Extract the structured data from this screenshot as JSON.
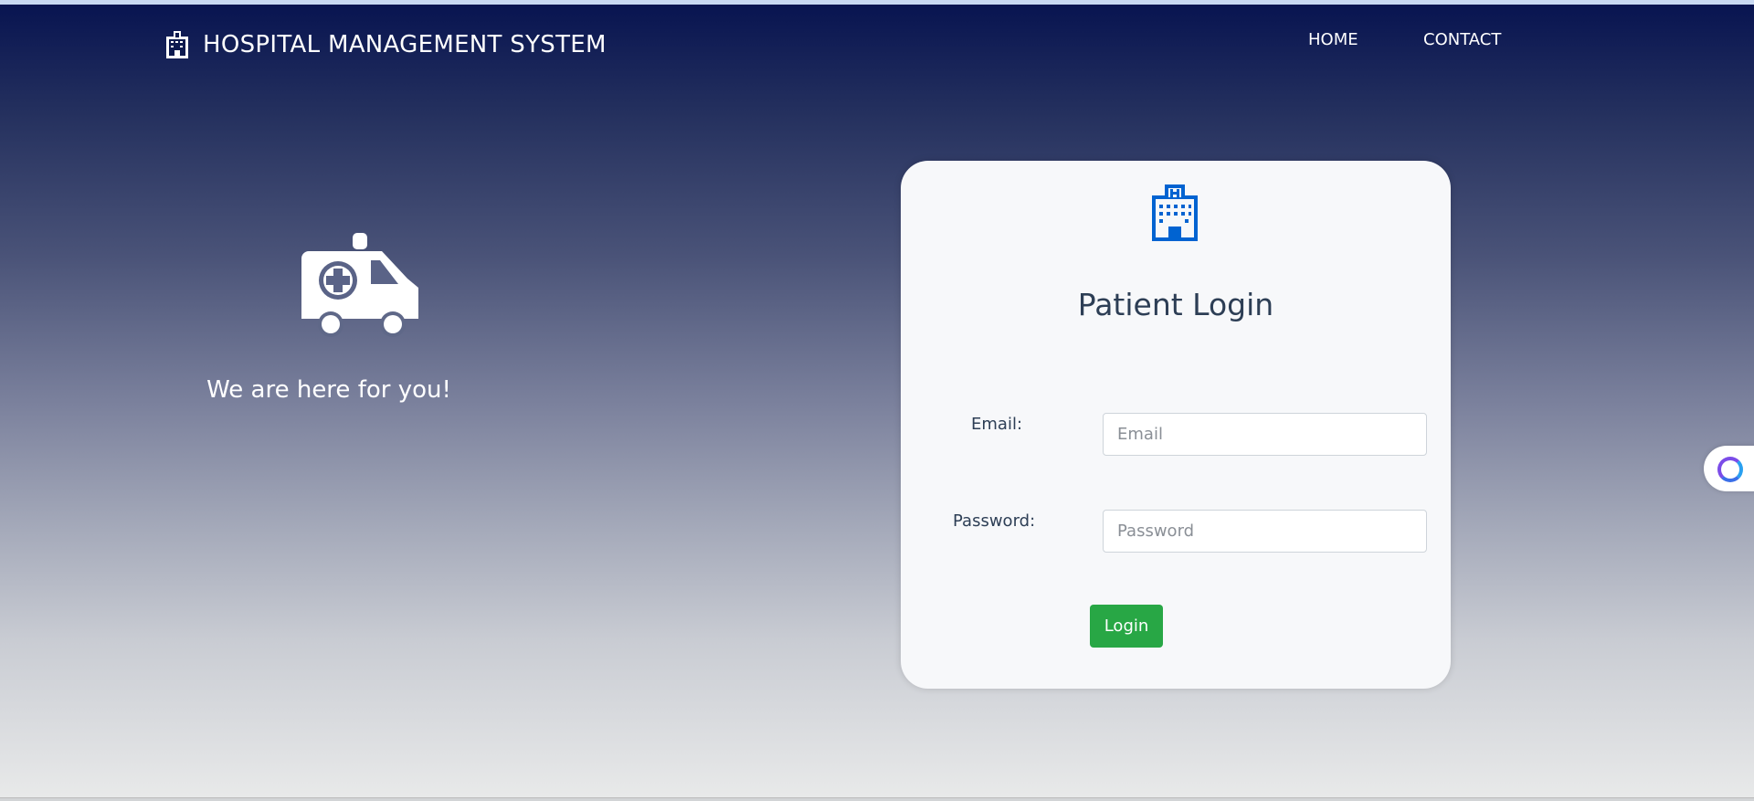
{
  "header": {
    "title": "HOSPITAL MANAGEMENT SYSTEM",
    "nav": [
      {
        "label": "HOME"
      },
      {
        "label": "CONTACT"
      }
    ]
  },
  "hero": {
    "tagline": "We are here for you!"
  },
  "login": {
    "title": "Patient Login",
    "email_label": "Email:",
    "email_placeholder": "Email",
    "password_label": "Password:",
    "password_placeholder": "Password",
    "button_label": "Login"
  },
  "colors": {
    "accent": "#0063d1",
    "button": "#28a745",
    "text": "#2d3e55"
  }
}
